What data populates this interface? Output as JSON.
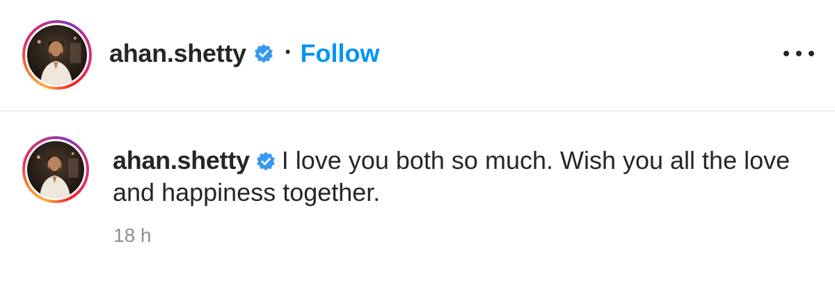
{
  "post_header": {
    "username": "ahan.shetty",
    "verified_icon": "verified-badge-icon",
    "separator": "•",
    "follow_label": "Follow",
    "more_icon": "more-options-icon"
  },
  "comment": {
    "username": "ahan.shetty",
    "verified_icon": "verified-badge-icon",
    "text": "I love you both so much. Wish you all the love and happiness together.",
    "timestamp": "18 h"
  },
  "colors": {
    "follow_blue": "#0095f6",
    "verified_blue": "#3897f0",
    "text_dark": "#262626",
    "text_muted": "#8e8e8e",
    "divider": "#dbdbdb"
  }
}
